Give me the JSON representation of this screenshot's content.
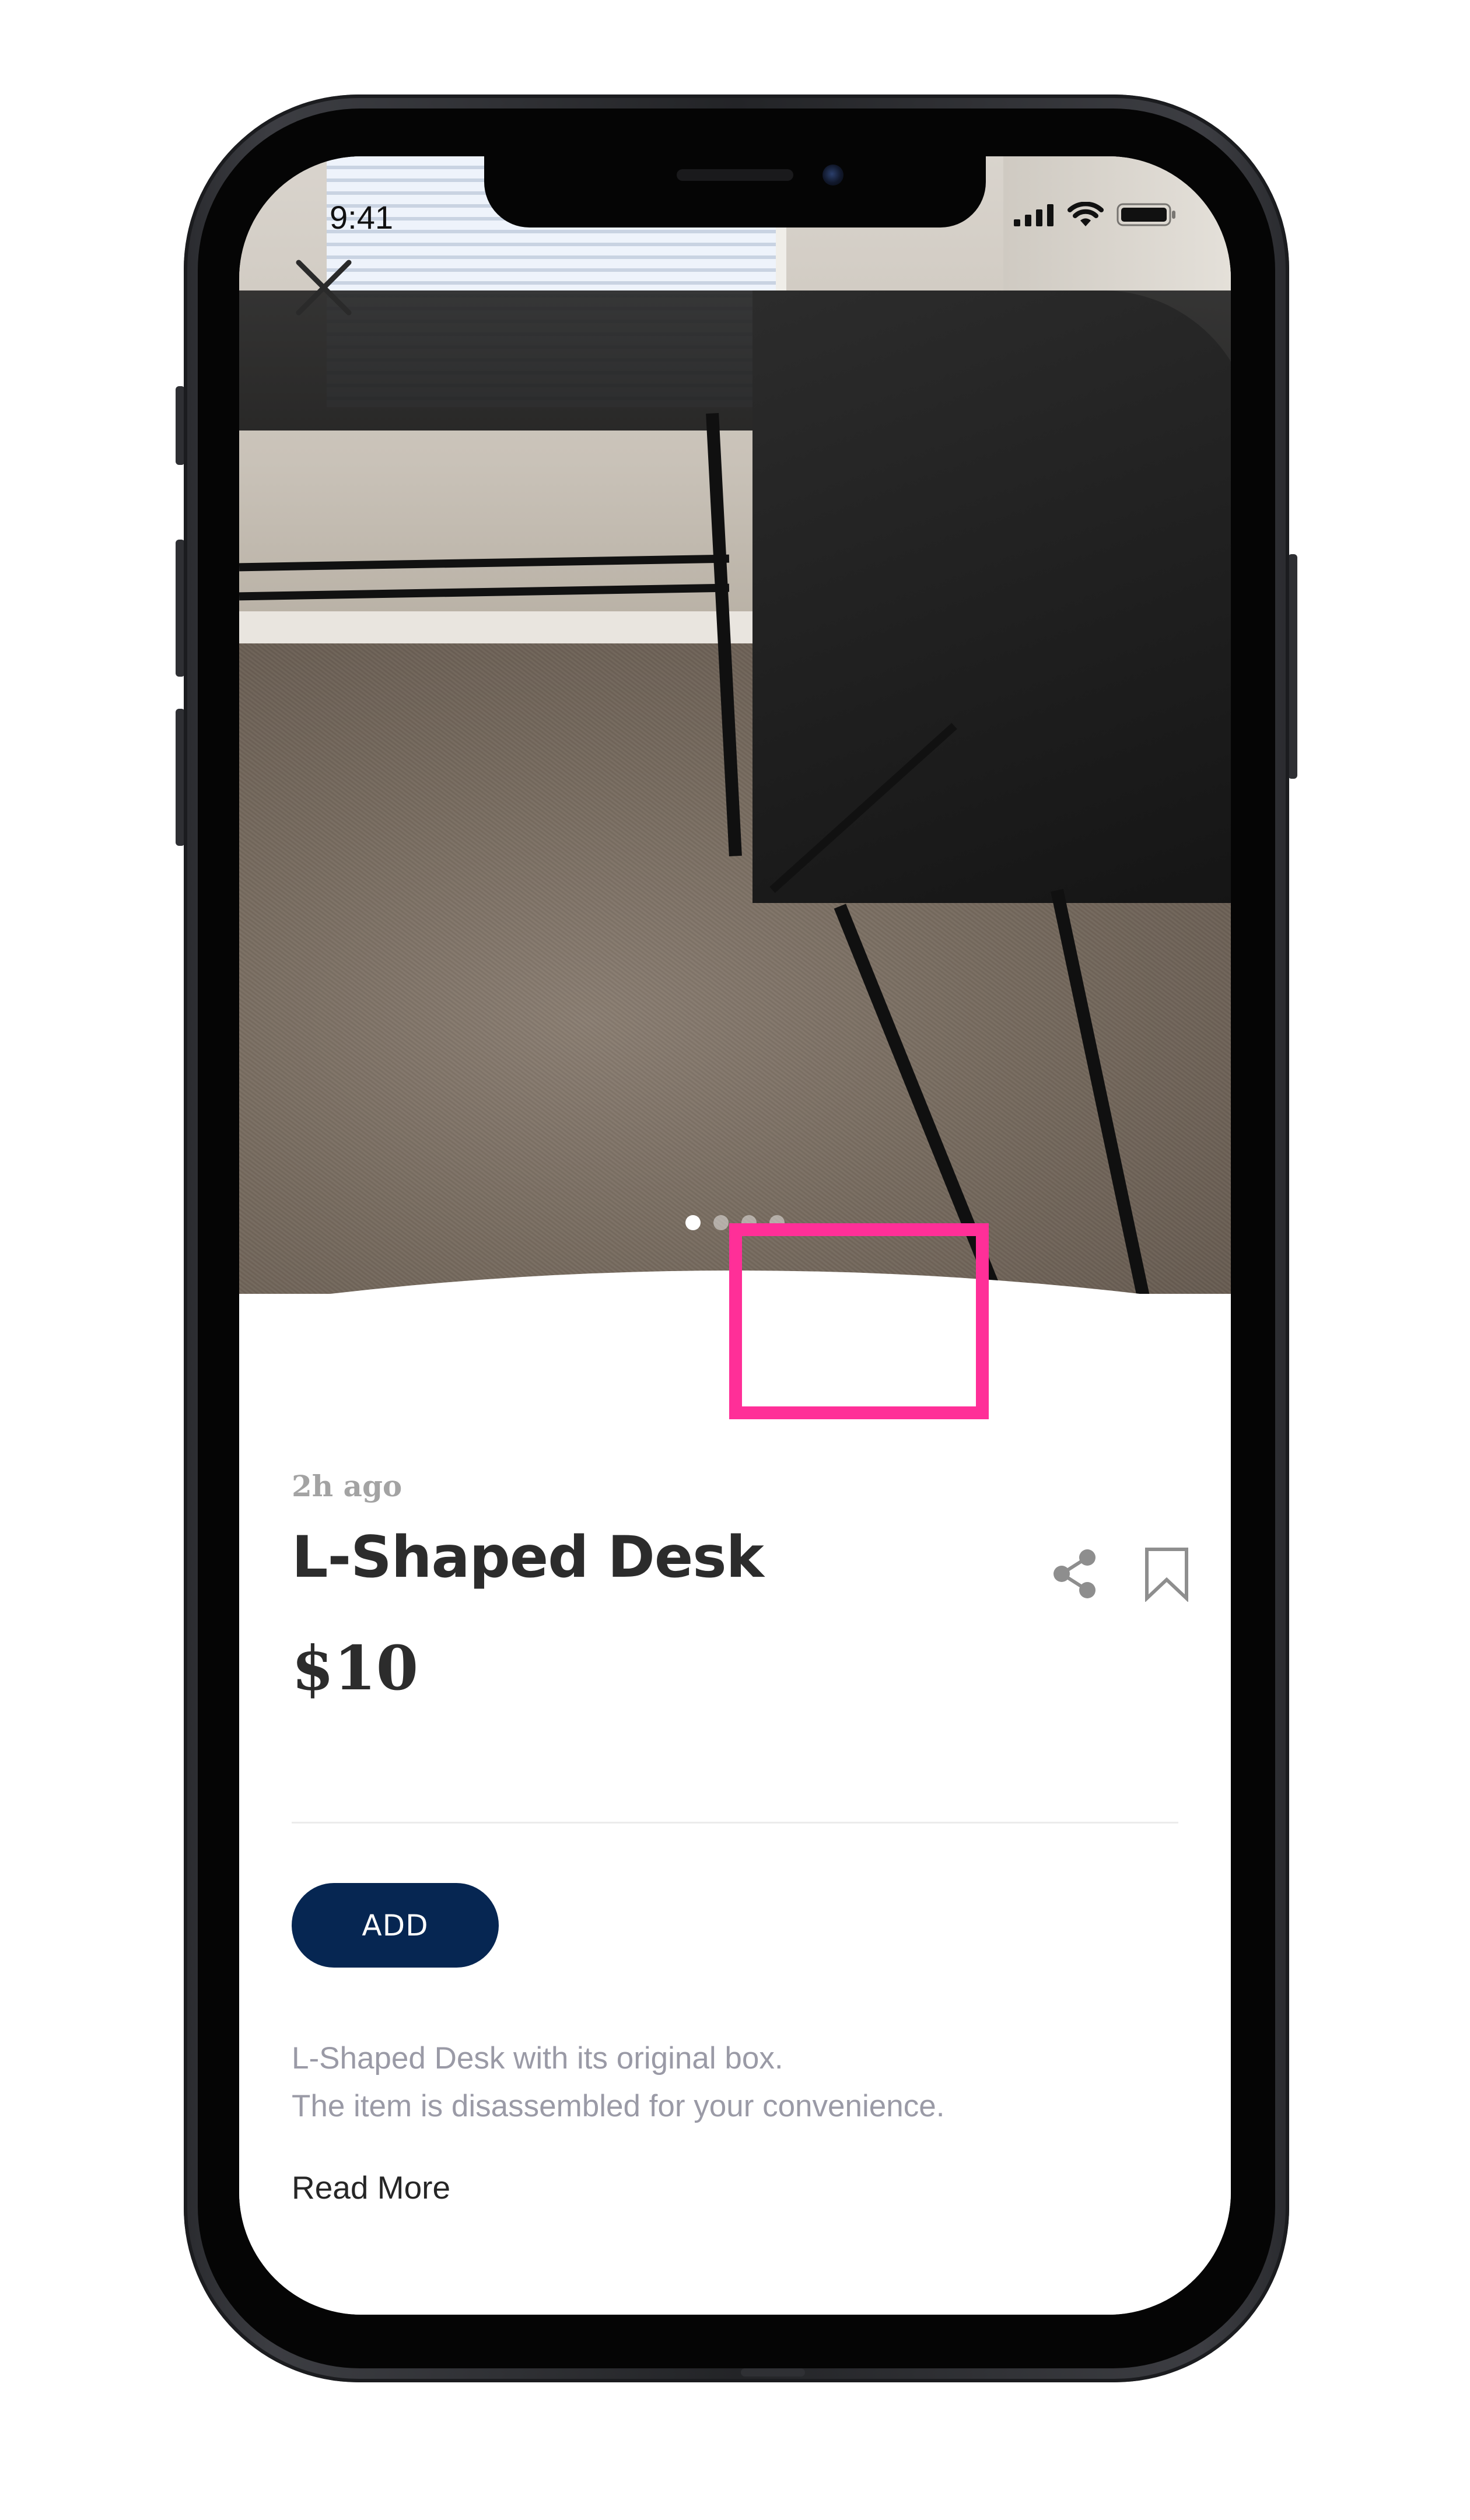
{
  "status_bar": {
    "time": "9:41",
    "icons": [
      "signal-icon",
      "wifi-icon",
      "battery-icon"
    ]
  },
  "photo": {
    "description_icon": "close-icon",
    "carousel": {
      "count": 4,
      "active_index": 0
    }
  },
  "listing": {
    "posted": "2h ago",
    "title": "L-Shaped Desk",
    "price": "$10",
    "add_label": "ADD",
    "description_lines": [
      "L-Shaped Desk with its original box.",
      "The item is disassembled for your convenience."
    ],
    "read_more": "Read More",
    "actions": [
      "share-icon",
      "bookmark-icon"
    ]
  },
  "colors": {
    "accent": "#062652",
    "highlight": "#ff2f98",
    "muted_text": "#9a9aa6"
  }
}
